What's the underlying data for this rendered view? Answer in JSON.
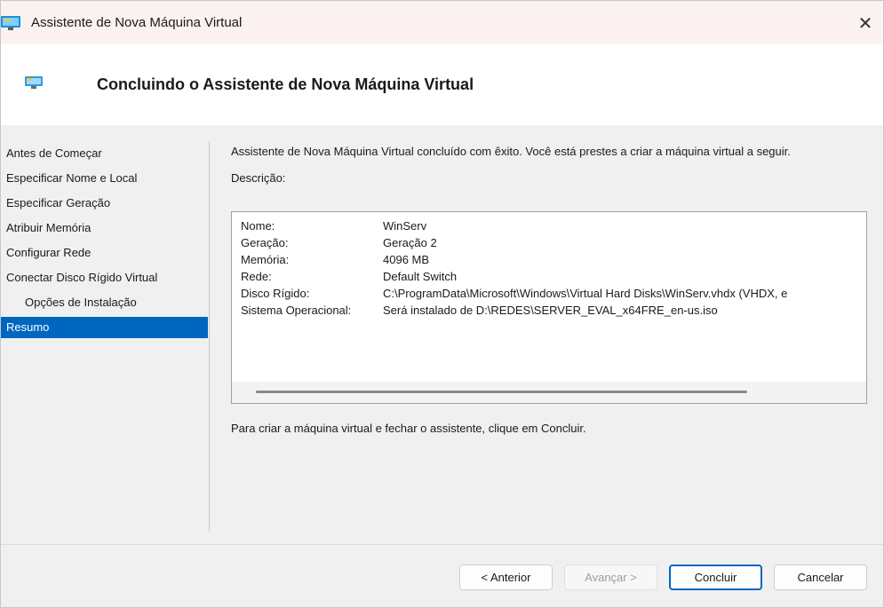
{
  "window": {
    "title": "Assistente de Nova Máquina Virtual",
    "close_glyph": "✕"
  },
  "header": {
    "heading": "Concluindo o Assistente de Nova Máquina Virtual"
  },
  "nav": {
    "items": [
      {
        "label": "Antes de Começar"
      },
      {
        "label": "Especificar Nome e Local"
      },
      {
        "label": "Especificar Geração"
      },
      {
        "label": "Atribuir Memória"
      },
      {
        "label": "Configurar Rede"
      },
      {
        "label": "Conectar Disco Rígido Virtual"
      },
      {
        "label": "Opções de Instalação"
      },
      {
        "label": "Resumo"
      }
    ],
    "selected": "Resumo"
  },
  "main": {
    "intro": "Assistente de Nova Máquina Virtual concluído com êxito. Você está prestes a criar a máquina virtual a seguir.",
    "description_label": "Descrição:",
    "summary": [
      {
        "key": "Nome:",
        "value": "WinServ"
      },
      {
        "key": "Geração:",
        "value": "Geração 2"
      },
      {
        "key": "Memória:",
        "value": "4096 MB"
      },
      {
        "key": "Rede:",
        "value": "Default Switch"
      },
      {
        "key": "Disco Rígido:",
        "value": "C:\\ProgramData\\Microsoft\\Windows\\Virtual Hard Disks\\WinServ.vhdx (VHDX, e"
      },
      {
        "key": "Sistema Operacional:",
        "value": "Será instalado de D:\\REDES\\SERVER_EVAL_x64FRE_en-us.iso"
      }
    ],
    "finish_text": "Para criar a máquina virtual e fechar o assistente, clique em Concluir."
  },
  "footer": {
    "previous": "< Anterior",
    "next": "Avançar >",
    "finish": "Concluir",
    "cancel": "Cancelar"
  },
  "colors": {
    "accent": "#0067c0",
    "titlebar": "#fbf1f1"
  },
  "icons": {
    "app": "hyperv-monitor-icon",
    "close": "close-icon"
  }
}
